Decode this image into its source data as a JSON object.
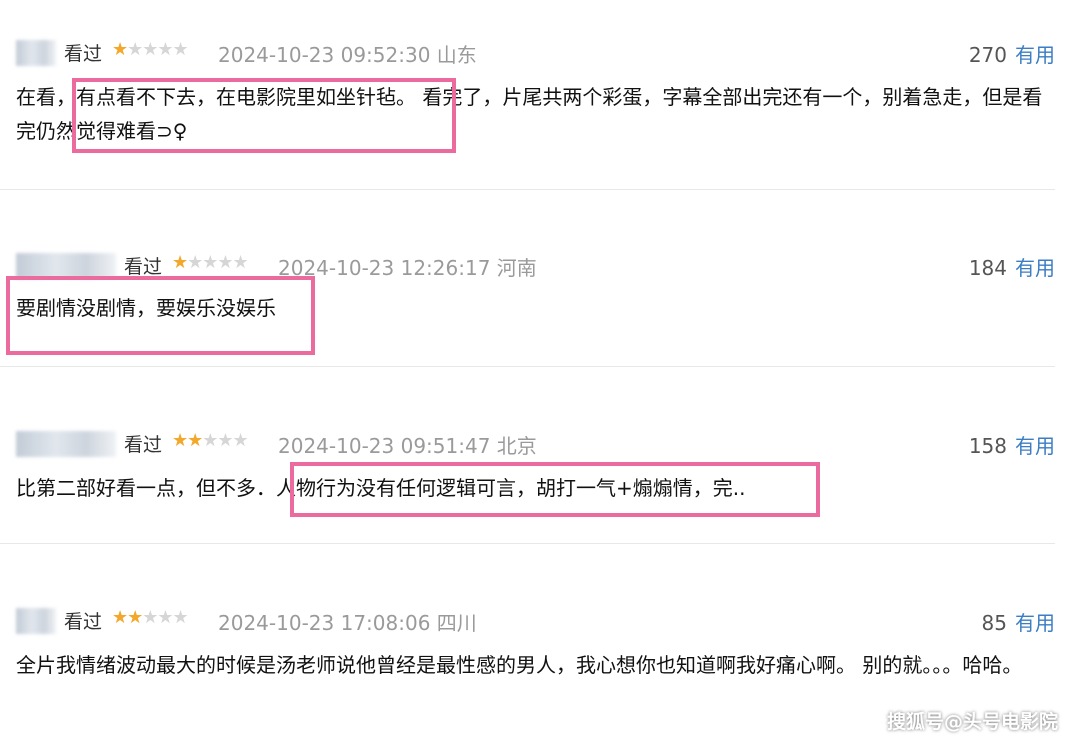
{
  "colors": {
    "accent": "#3b7ec3",
    "highlight_box": "#ec6b9e",
    "star_on": "#f3a82b",
    "star_off": "#d6d6d6"
  },
  "reviews": [
    {
      "watched": "看过",
      "rating": 1,
      "max_rating": 5,
      "time": "2024-10-23 09:52:30 山东",
      "votes": "270",
      "useful": "有用",
      "content": "在看，有点看不下去，在电影院里如坐针毡。 看完了，片尾共两个彩蛋，字幕全部出完还有一个，别着急走，但是看完仍然觉得难看⊃♀"
    },
    {
      "watched": "看过",
      "rating": 1,
      "max_rating": 5,
      "time": "2024-10-23 12:26:17 河南",
      "votes": "184",
      "useful": "有用",
      "content": "要剧情没剧情，要娱乐没娱乐"
    },
    {
      "watched": "看过",
      "rating": 2,
      "max_rating": 5,
      "time": "2024-10-23 09:51:47 北京",
      "votes": "158",
      "useful": "有用",
      "content": "比第二部好看一点，但不多．人物行为没有任何逻辑可言，胡打一气+煽煽情，完.."
    },
    {
      "watched": "看过",
      "rating": 2,
      "max_rating": 5,
      "time": "2024-10-23 17:08:06 四川",
      "votes": "85",
      "useful": "有用",
      "content": "全片我情绪波动最大的时候是汤老师说他曾经是最性感的男人，我心想你也知道啊我好痛心啊。 别的就。。。哈哈。"
    }
  ],
  "watermark": "搜狐号@头号电影院"
}
